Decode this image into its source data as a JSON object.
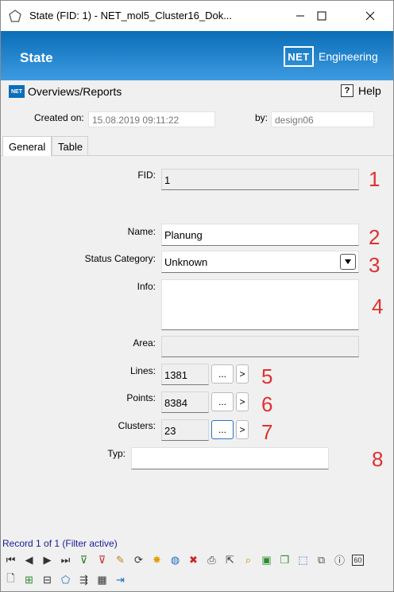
{
  "window": {
    "title": "State (FID: 1) - NET_mol5_Cluster16_Dok...",
    "minimize": "—",
    "maximize": "☐",
    "close": "✕"
  },
  "banner": {
    "title": "State",
    "logo": "NET",
    "logo_text": "Engineering"
  },
  "reports": {
    "label": "Overviews/Reports",
    "logo": "NET"
  },
  "help": {
    "label": "Help",
    "icon": "?"
  },
  "meta": {
    "created_label": "Created on:",
    "created_value": "15.08.2019 09:11:22",
    "by_label": "by:",
    "by_value": "design06"
  },
  "tabs": [
    {
      "label": "General"
    },
    {
      "label": "Table"
    }
  ],
  "form": {
    "fid_label": "FID:",
    "fid_value": "1",
    "name_label": "Name:",
    "name_value": "Planung",
    "status_label": "Status Category:",
    "status_value": "Unknown",
    "info_label": "Info:",
    "info_value": "",
    "area_label": "Area:",
    "area_value": "",
    "lines_label": "Lines:",
    "lines_value": "1381",
    "points_label": "Points:",
    "points_value": "8384",
    "clusters_label": "Clusters:",
    "clusters_value": "23",
    "typ_label": "Typ:",
    "typ_value": "",
    "ellipsis": "...",
    "go": ">"
  },
  "annotations": [
    "1",
    "2",
    "3",
    "4",
    "5",
    "6",
    "7",
    "8"
  ],
  "status": {
    "text": "Record 1 of 1 (Filter active)"
  },
  "toolbar1": [
    {
      "icon": "first-record-icon",
      "glyph": "⏮"
    },
    {
      "icon": "previous-record-icon",
      "glyph": "◀"
    },
    {
      "icon": "next-record-icon",
      "glyph": "▶"
    },
    {
      "icon": "last-record-icon",
      "glyph": "⏭"
    },
    {
      "icon": "add-filter-icon",
      "glyph": "⊽"
    },
    {
      "icon": "remove-filter-icon",
      "glyph": "⊽"
    },
    {
      "icon": "edit-icon",
      "glyph": "✎"
    },
    {
      "icon": "refresh-icon",
      "glyph": "⟳"
    },
    {
      "icon": "new-icon",
      "glyph": "✸"
    },
    {
      "icon": "globe-icon",
      "glyph": "◍"
    },
    {
      "icon": "delete-icon",
      "glyph": "✖"
    },
    {
      "icon": "print-icon",
      "glyph": "⎙"
    },
    {
      "icon": "select-icon",
      "glyph": "⇱"
    },
    {
      "icon": "zoom-icon",
      "glyph": "⌕"
    },
    {
      "icon": "box-icon",
      "glyph": "▣"
    },
    {
      "icon": "copy-box-icon",
      "glyph": "❐"
    },
    {
      "icon": "dashed-box-icon",
      "glyph": "⬚"
    },
    {
      "icon": "layers-icon",
      "glyph": "⧉"
    },
    {
      "icon": "info-icon",
      "glyph": "ⓘ"
    },
    {
      "icon": "sixty-icon",
      "glyph": "60"
    }
  ],
  "toolbar2": [
    {
      "icon": "document-icon",
      "glyph": "🗋"
    },
    {
      "icon": "report-add-icon",
      "glyph": "⊞"
    },
    {
      "icon": "report-export-icon",
      "glyph": "⊟"
    },
    {
      "icon": "pentagon-icon",
      "glyph": "⬠"
    },
    {
      "icon": "split-icon",
      "glyph": "⇶"
    },
    {
      "icon": "table-edit-icon",
      "glyph": "▦"
    },
    {
      "icon": "login-icon",
      "glyph": "⇥"
    }
  ],
  "colors": {
    "banner_top": "#0a6eb8",
    "banner_bottom": "#3d9be0",
    "annotation_red": "#e03030",
    "status_blue": "#1a1aa0"
  }
}
